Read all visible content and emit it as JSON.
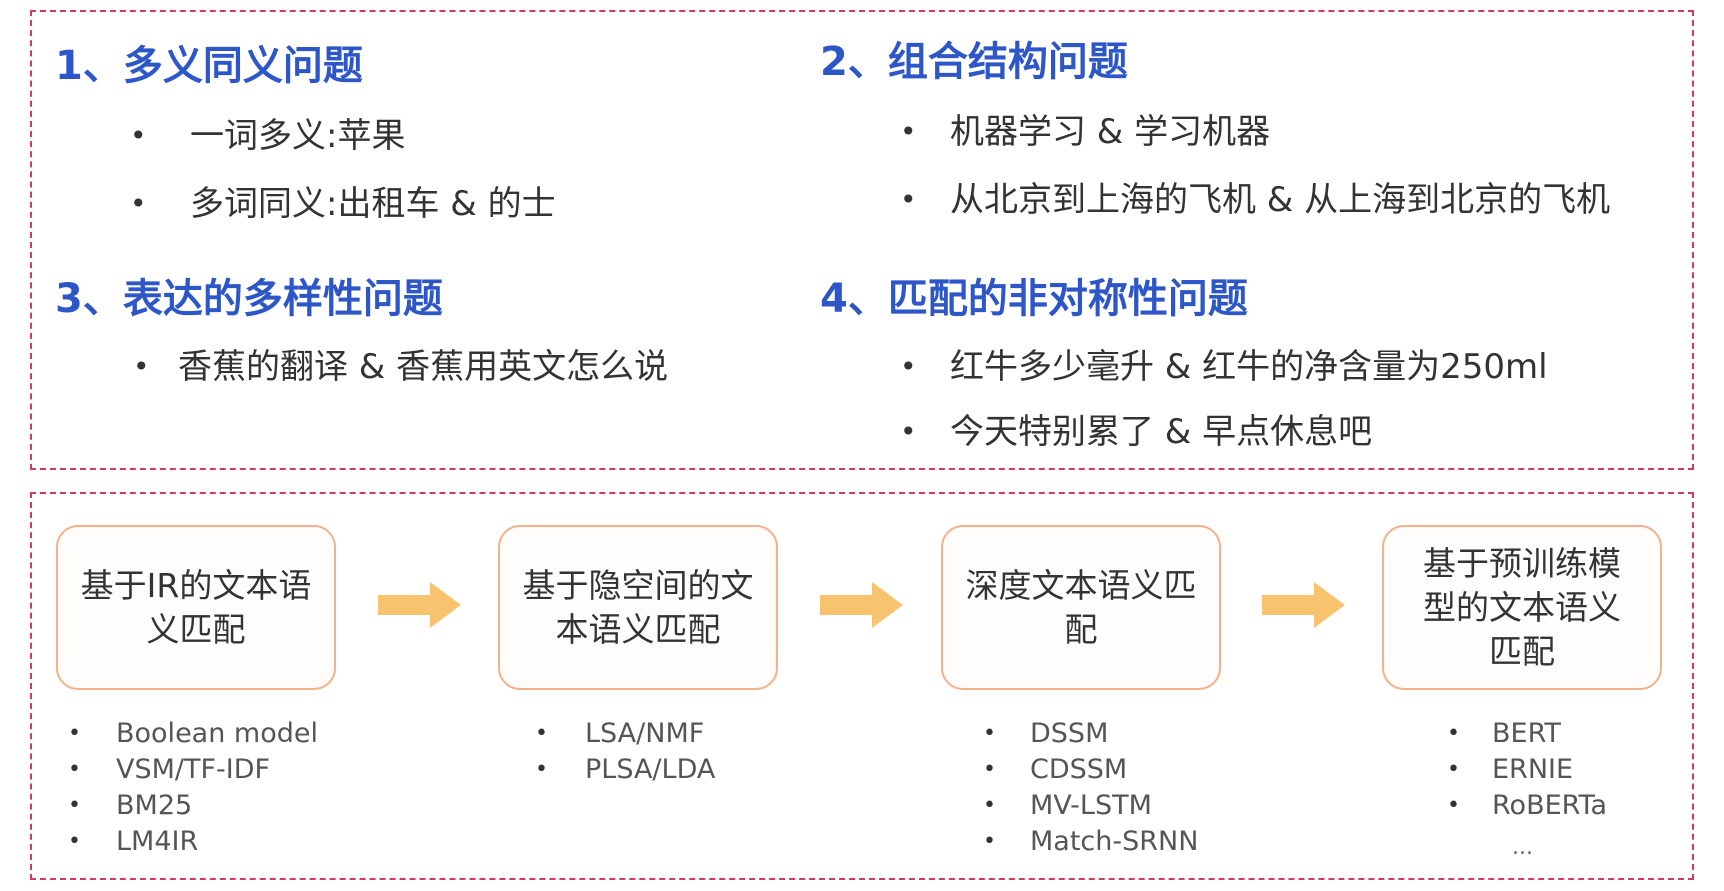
{
  "problems": [
    {
      "title": "1、多义同义问题",
      "items": [
        "一词多义:苹果",
        "多词同义:出租车 & 的士"
      ]
    },
    {
      "title": "2、组合结构问题",
      "items": [
        "机器学习 & 学习机器",
        "从北京到上海的飞机 & 从上海到北京的飞机"
      ]
    },
    {
      "title": "3、表达的多样性问题",
      "items": [
        "香蕉的翻译 & 香蕉用英文怎么说"
      ]
    },
    {
      "title": "4、匹配的非对称性问题",
      "items": [
        "红牛多少毫升 & 红牛的净含量为250ml",
        "今天特别累了 & 早点休息吧"
      ]
    }
  ],
  "bullet_symbol": "•",
  "stages": [
    {
      "label": "基于IR的文本语义匹配",
      "methods": [
        "Boolean model",
        "VSM/TF-IDF",
        "BM25",
        "LM4IR"
      ]
    },
    {
      "label": "基于隐空间的文本语义匹配",
      "methods": [
        "LSA/NMF",
        "PLSA/LDA"
      ]
    },
    {
      "label": "深度文本语义匹配",
      "methods": [
        "DSSM",
        "CDSSM",
        "MV-LSTM",
        "Match-SRNN"
      ]
    },
    {
      "label": "基于预训练模型的文本语义匹配",
      "methods": [
        "BERT",
        "ERNIE",
        "RoBERTa"
      ],
      "more": "..."
    }
  ],
  "colors": {
    "title_blue": "#2d56c8",
    "border_red": "#d33a5c",
    "box_border": "#f4b08a",
    "arrow": "#f8c36e"
  },
  "icons": {
    "flow_arrow": "arrow-right-icon"
  }
}
